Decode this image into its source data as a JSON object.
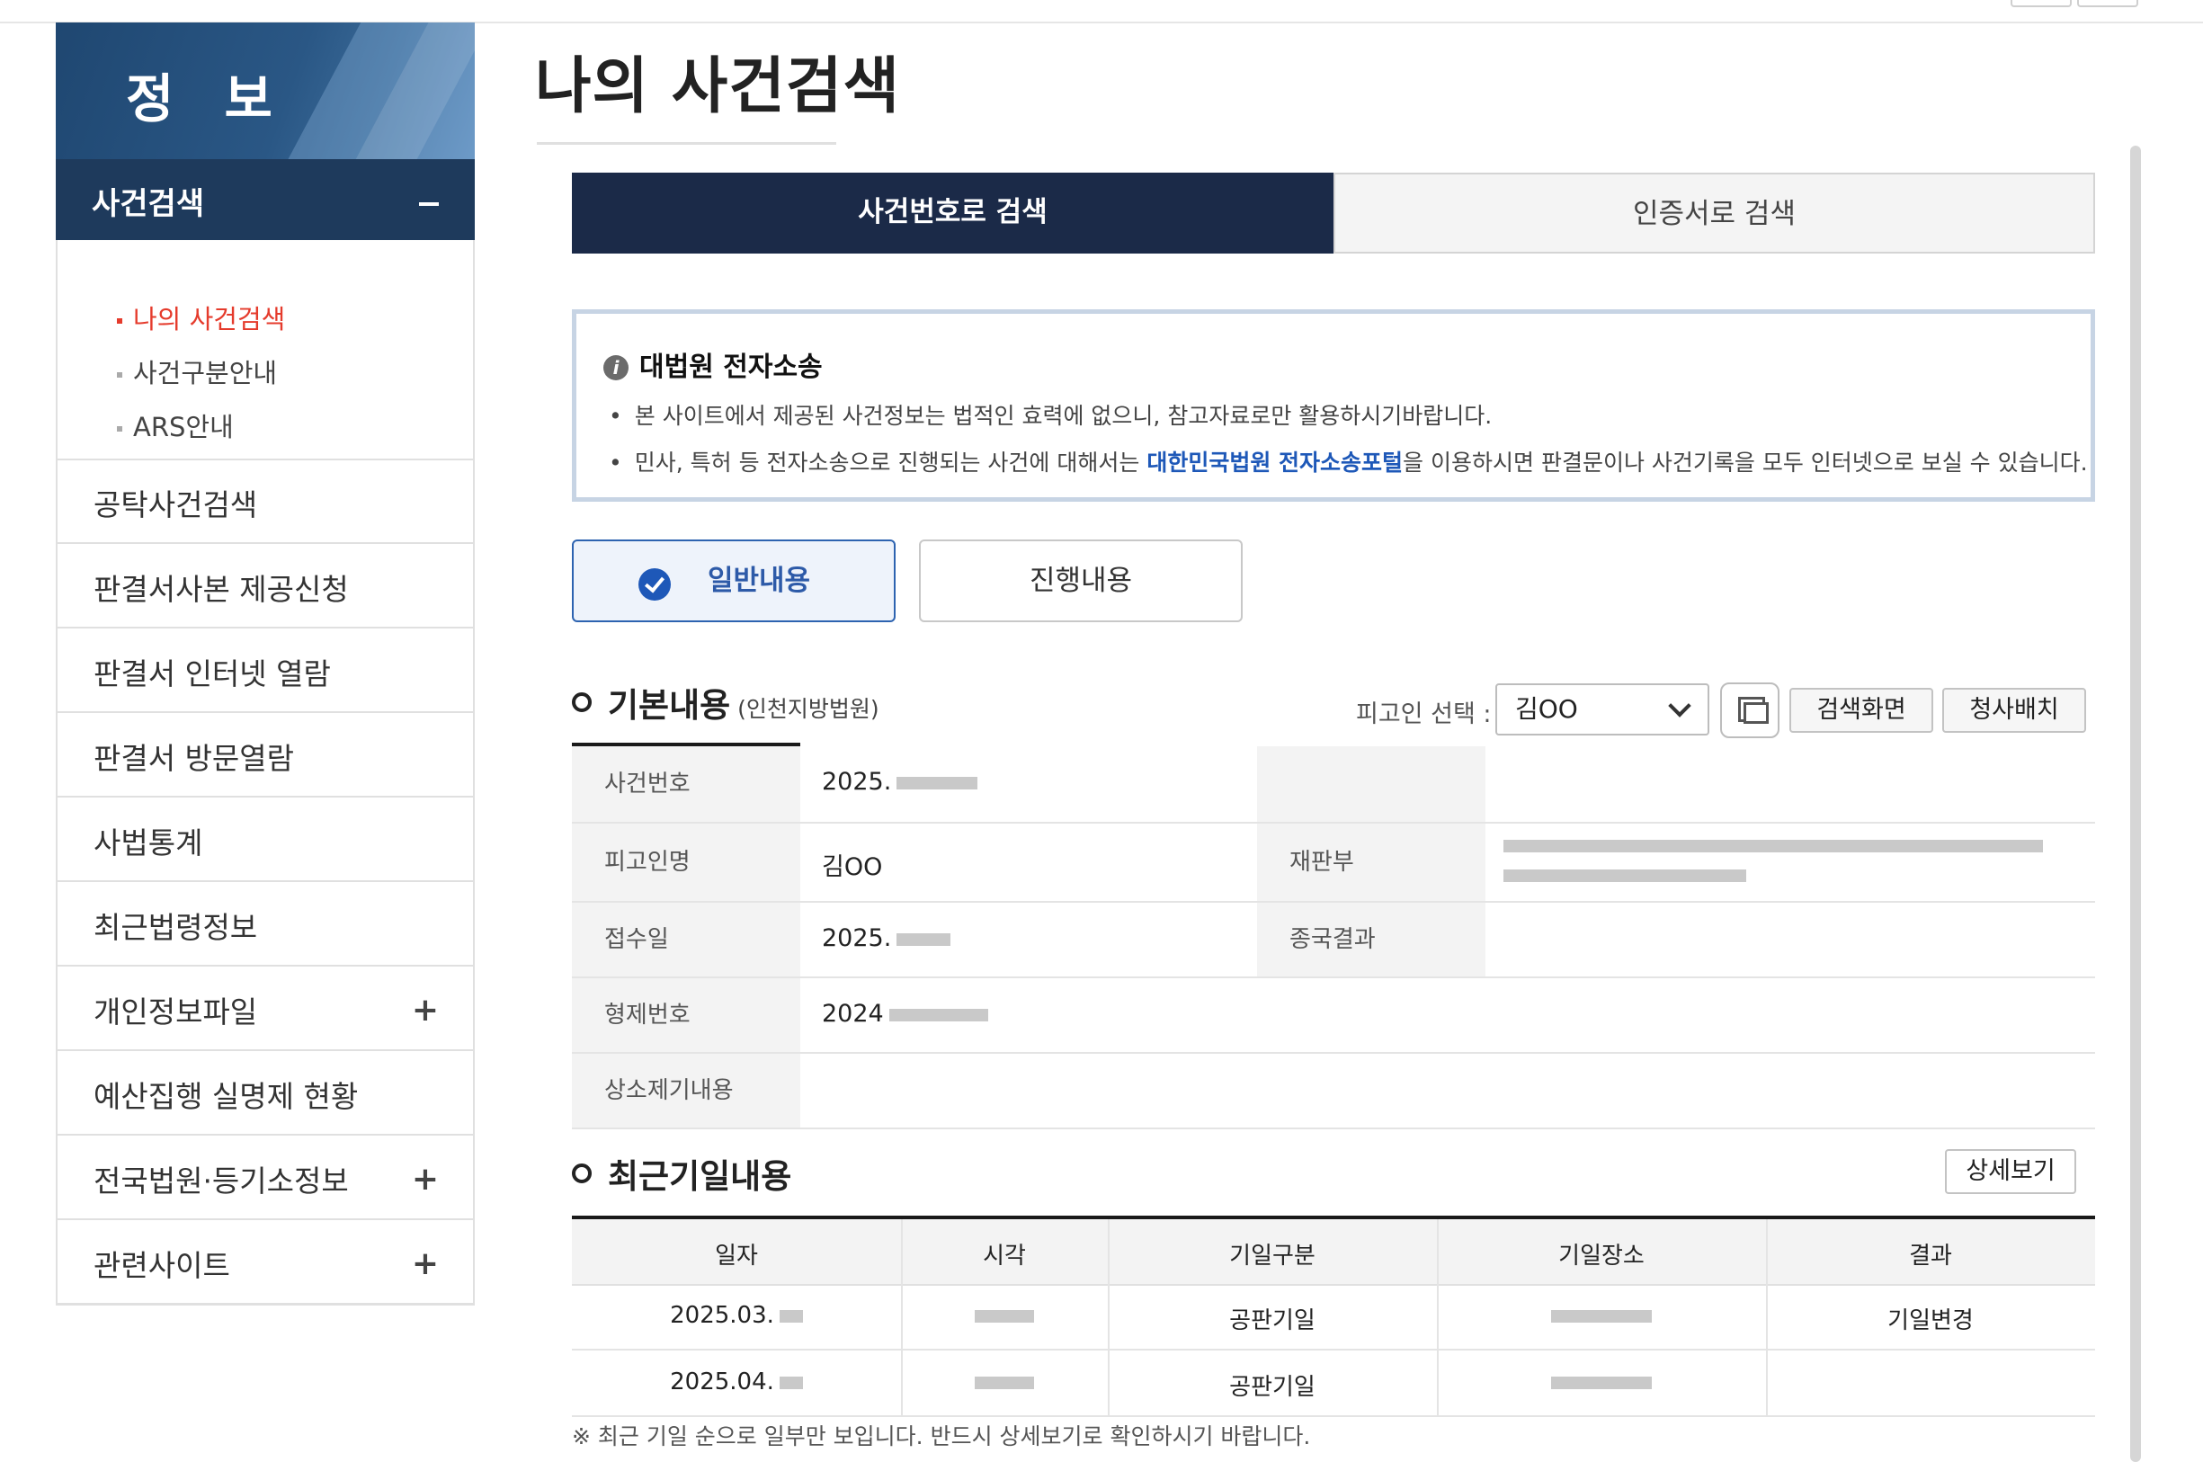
{
  "sidebar": {
    "title": "정 보",
    "active_section": "사건검색",
    "submenu": [
      "나의 사건검색",
      "사건구분안내",
      "ARS안내"
    ],
    "items": [
      {
        "label": "공탁사건검색",
        "expandable": false
      },
      {
        "label": "판결서사본 제공신청",
        "expandable": false
      },
      {
        "label": "판결서 인터넷 열람",
        "expandable": false
      },
      {
        "label": "판결서 방문열람",
        "expandable": false
      },
      {
        "label": "사법통계",
        "expandable": false
      },
      {
        "label": "최근법령정보",
        "expandable": false
      },
      {
        "label": "개인정보파일",
        "expandable": true
      },
      {
        "label": "예산집행 실명제 현황",
        "expandable": false
      },
      {
        "label": "전국법원·등기소정보",
        "expandable": true
      },
      {
        "label": "관련사이트",
        "expandable": true
      }
    ],
    "plus": "+"
  },
  "page": {
    "title": "나의 사건검색"
  },
  "tabs": {
    "by_case_number": "사건번호로 검색",
    "by_certificate": "인증서로 검색"
  },
  "notice": {
    "icon": "i",
    "heading": "대법원 전자소송",
    "bullet": "•",
    "line1": "본 사이트에서 제공된 사건정보는 법적인 효력에 없으니, 참고자료로만 활용하시기바랍니다.",
    "line2_pre": "민사, 특허 등 전자소송으로 진행되는 사건에 대해서는 ",
    "line2_link": "대한민국법원 전자소송포털",
    "line2_post": "을 이용하시면 판결문이나 사건기록을 모두 인터넷으로 보실 수 있습니다."
  },
  "view_toggle": {
    "general": "일반내용",
    "progress": "진행내용"
  },
  "basic": {
    "title": "기본내용",
    "court": "(인천지방법원)",
    "defendant_select_label": "피고인 선택 :",
    "defendant_selected": "김OO",
    "search_screen_button": "검색화면",
    "courthouse_button": "청사배치",
    "rows": {
      "case_number_label": "사건번호",
      "case_number_value": "2025.",
      "defendant_label": "피고인명",
      "defendant_value": "김OO",
      "division_label": "재판부",
      "received_label": "접수일",
      "received_value": "2025.",
      "final_label": "종국결과",
      "related_label": "형제번호",
      "related_value": "2024",
      "appeal_label": "상소제기내용"
    }
  },
  "recent": {
    "title": "최근기일내용",
    "detail_button": "상세보기",
    "columns": [
      "일자",
      "시각",
      "기일구분",
      "기일장소",
      "결과"
    ],
    "rows": [
      {
        "date": "2025.03.",
        "type": "공판기일",
        "result": "기일변경"
      },
      {
        "date": "2025.04.",
        "type": "공판기일",
        "result": ""
      }
    ],
    "footnote": "※ 최근 기일 순으로 일부만 보입니다. 반드시 상세보기로 확인하시기 바랍니다."
  },
  "colors": {
    "accent_navy": "#1b2a48",
    "sidebar_active": "#1e3a5c",
    "link_blue": "#1e58b8",
    "active_red": "#e53b2c"
  }
}
